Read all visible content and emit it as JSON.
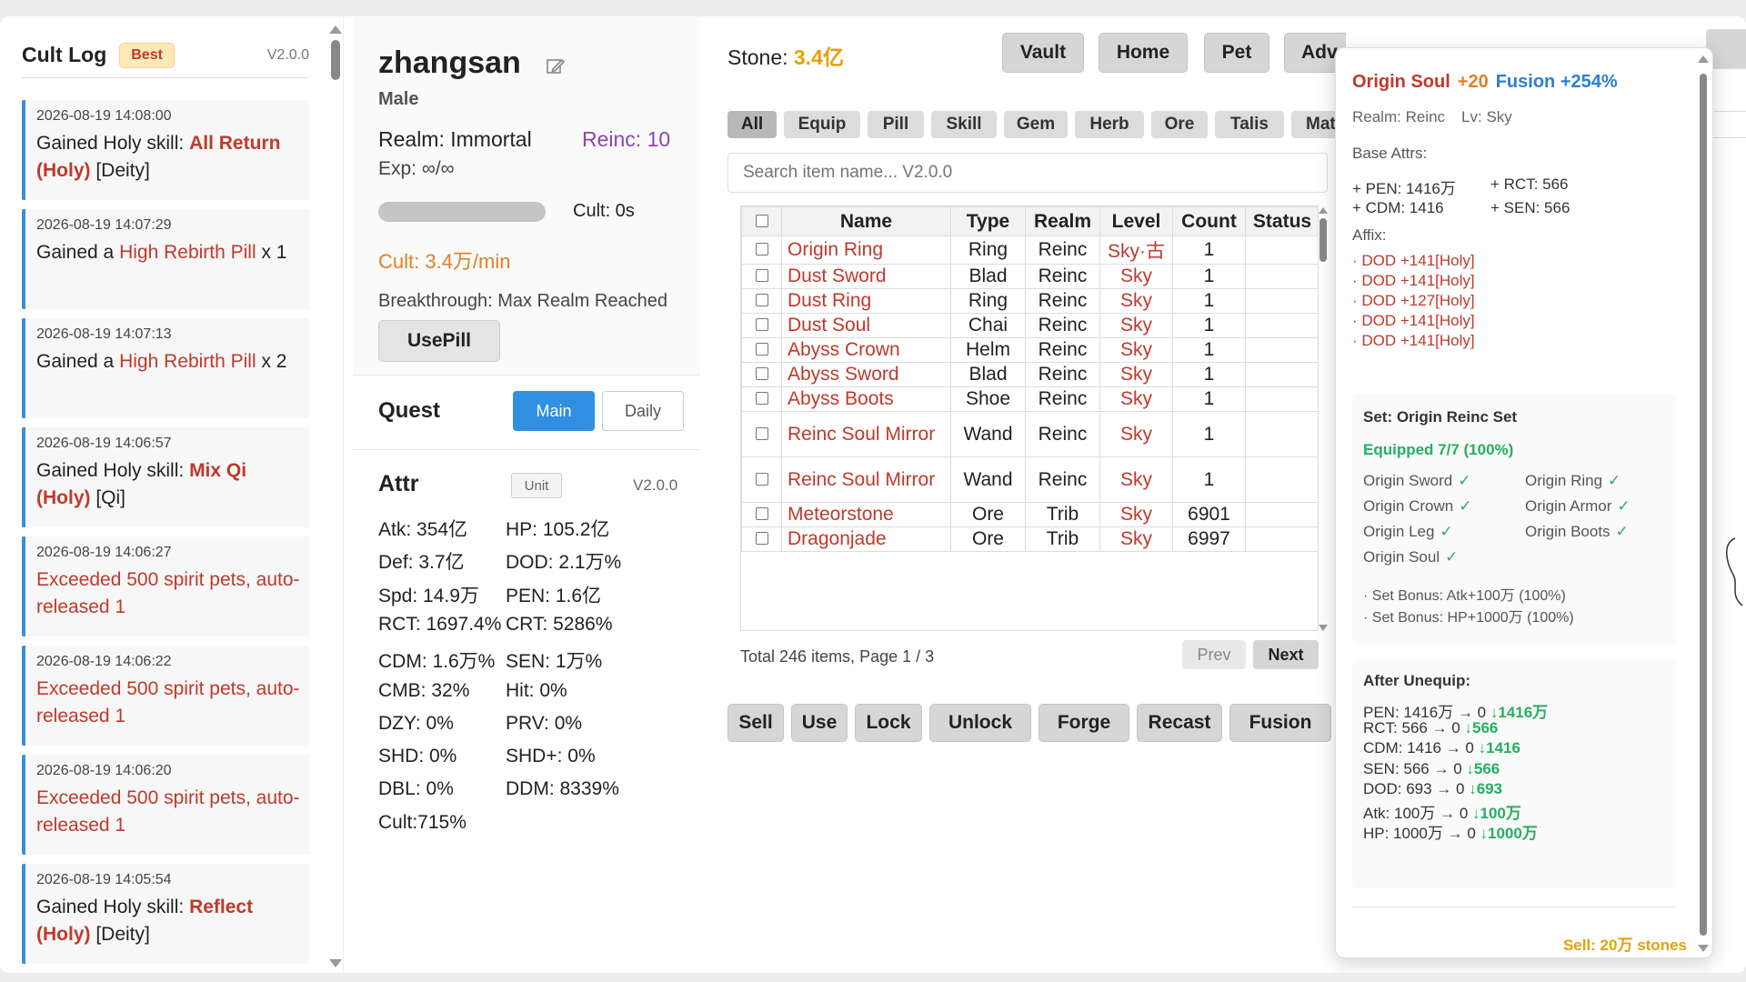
{
  "log": {
    "title": "Cult Log",
    "badge": "Best",
    "version": "V2.0.0",
    "items": [
      {
        "time": "2026-08-19 14:08:00",
        "prefix": "Gained Holy skill: ",
        "highlight": "All Return (Holy)",
        "suffix": " [Deity]"
      },
      {
        "time": "2026-08-19 14:07:29",
        "prefix": "Gained a ",
        "highlight": "High Rebirth Pill",
        "suffix": " x 1"
      },
      {
        "time": "2026-08-19 14:07:13",
        "prefix": "Gained a ",
        "highlight": "High Rebirth Pill",
        "suffix": " x 2"
      },
      {
        "time": "2026-08-19 14:06:57",
        "prefix": "Gained Holy skill: ",
        "highlight": "Mix Qi (Holy)",
        "suffix": " [Qi]"
      },
      {
        "time": "2026-08-19 14:06:27",
        "text": "Exceeded 500 spirit pets, auto-released 1"
      },
      {
        "time": "2026-08-19 14:06:22",
        "text": "Exceeded 500 spirit pets, auto-released 1"
      },
      {
        "time": "2026-08-19 14:06:20",
        "text": "Exceeded 500 spirit pets, auto-released 1"
      },
      {
        "time": "2026-08-19 14:05:54",
        "prefix": "Gained Holy skill: ",
        "highlight": "Reflect (Holy)",
        "suffix": " [Deity]"
      }
    ]
  },
  "character": {
    "name": "zhangsan",
    "gender": "Male",
    "realm": "Realm: Immortal",
    "reinc": "Reinc: 10",
    "exp": "Exp: ∞/∞",
    "exp_progress": 1.0,
    "cult_time": "Cult: 0s",
    "cult_rate": "Cult:   3.4万/min",
    "breakthrough": "Breakthrough: Max Realm Reached",
    "use_pill": "UsePill"
  },
  "quest": {
    "title": "Quest",
    "tabs": [
      "Main",
      "Daily"
    ],
    "active_tab": "Main"
  },
  "attr": {
    "title": "Attr",
    "unit_btn": "Unit",
    "version": "V2.0.0",
    "left": [
      "Atk: 354亿",
      "Def: 3.7亿",
      "Spd: 14.9万",
      "RCT: 1697.4%",
      "CDM: 1.6万%",
      "CMB: 32%",
      "DZY: 0%",
      "SHD: 0%",
      "DBL: 0%",
      "Cult:715%"
    ],
    "right": [
      "HP: 105.2亿",
      "DOD: 2.1万%",
      "PEN: 1.6亿",
      "CRT: 5286%",
      "SEN: 1万%",
      "Hit: 0%",
      "PRV: 0%",
      "SHD+: 0%",
      "DDM: 8339%"
    ]
  },
  "inventory": {
    "stone_label": "Stone: ",
    "stone_value": "3.4亿",
    "nav": [
      "Vault",
      "Home",
      "Pet",
      "Adv"
    ],
    "categories": [
      "All",
      "Equip",
      "Pill",
      "Skill",
      "Gem",
      "Herb",
      "Ore",
      "Talis",
      "Mat."
    ],
    "active_category": "All",
    "search_placeholder": "Search item name... V2.0.0",
    "columns": [
      "Name",
      "Type",
      "Realm",
      "Level",
      "Count",
      "Status"
    ],
    "rows": [
      {
        "name": "Origin Ring",
        "type": "Ring",
        "realm": "Reinc",
        "level": "Sky·古",
        "count": "1",
        "status": ""
      },
      {
        "name": "Dust Sword",
        "type": "Blad",
        "realm": "Reinc",
        "level": "Sky",
        "count": "1",
        "status": ""
      },
      {
        "name": "Dust Ring",
        "type": "Ring",
        "realm": "Reinc",
        "level": "Sky",
        "count": "1",
        "status": ""
      },
      {
        "name": "Dust Soul",
        "type": "Chai",
        "realm": "Reinc",
        "level": "Sky",
        "count": "1",
        "status": ""
      },
      {
        "name": "Abyss Crown",
        "type": "Helm",
        "realm": "Reinc",
        "level": "Sky",
        "count": "1",
        "status": ""
      },
      {
        "name": "Abyss Sword",
        "type": "Blad",
        "realm": "Reinc",
        "level": "Sky",
        "count": "1",
        "status": ""
      },
      {
        "name": "Abyss Boots",
        "type": "Shoe",
        "realm": "Reinc",
        "level": "Sky",
        "count": "1",
        "status": ""
      },
      {
        "name": "Reinc Soul Mirror",
        "type": "Wand",
        "realm": "Reinc",
        "level": "Sky",
        "count": "1",
        "status": ""
      },
      {
        "name": "Reinc Soul Mirror",
        "type": "Wand",
        "realm": "Reinc",
        "level": "Sky",
        "count": "1",
        "status": ""
      },
      {
        "name": "Meteorstone",
        "type": "Ore",
        "realm": "Trib",
        "level": "Sky",
        "count": "6901",
        "status": ""
      },
      {
        "name": "Dragonjade",
        "type": "Ore",
        "realm": "Trib",
        "level": "Sky",
        "count": "6997",
        "status": ""
      }
    ],
    "pager_info": "Total 246 items, Page 1 / 3",
    "prev": "Prev",
    "next": "Next",
    "actions": [
      "Sell",
      "Use",
      "Lock",
      "Unlock",
      "Forge",
      "Recast",
      "Fusion"
    ]
  },
  "tooltip": {
    "name": "Origin Soul",
    "plus": "+20",
    "fusion": "Fusion +254%",
    "realm": "Realm: Reinc",
    "level": "Lv: Sky",
    "base_label": "Base Attrs:",
    "base": [
      "+ PEN:  1416万",
      "+ RCT:  566",
      "+ CDM:  1416",
      "+ SEN:  566"
    ],
    "affix_label": "Affix:",
    "affixes": [
      "· DOD +141[Holy]",
      "· DOD +141[Holy]",
      "· DOD +127[Holy]",
      "· DOD +141[Holy]",
      "· DOD +141[Holy]"
    ],
    "set_title": "Set: Origin Reinc Set",
    "set_equipped": "Equipped 7/7 (100%)",
    "set_pieces": [
      "Origin Sword",
      "Origin Ring",
      "Origin Crown",
      "Origin Armor",
      "Origin Leg",
      "Origin Boots",
      "Origin Soul"
    ],
    "check": "✓",
    "set_bonuses": [
      "· Set Bonus: Atk+100万 (100%)",
      "· Set Bonus: HP+1000万 (100%)"
    ],
    "unequip_title": "After Unequip:",
    "unequip": [
      {
        "label": "PEN:  1416万 → 0 ",
        "delta": "↓1416万"
      },
      {
        "label": "RCT:  566 → 0 ",
        "delta": "↓566"
      },
      {
        "label": "CDM:  1416 → 0 ",
        "delta": "↓1416"
      },
      {
        "label": "SEN:  566 → 0 ",
        "delta": "↓566"
      },
      {
        "label": "DOD:  693 → 0 ",
        "delta": "↓693"
      },
      {
        "label": "Atk:  100万 → 0 ",
        "delta": "↓100万"
      },
      {
        "label": "HP:  1000万 → 0 ",
        "delta": "↓1000万"
      }
    ],
    "sell": "Sell: 20万 stones"
  }
}
